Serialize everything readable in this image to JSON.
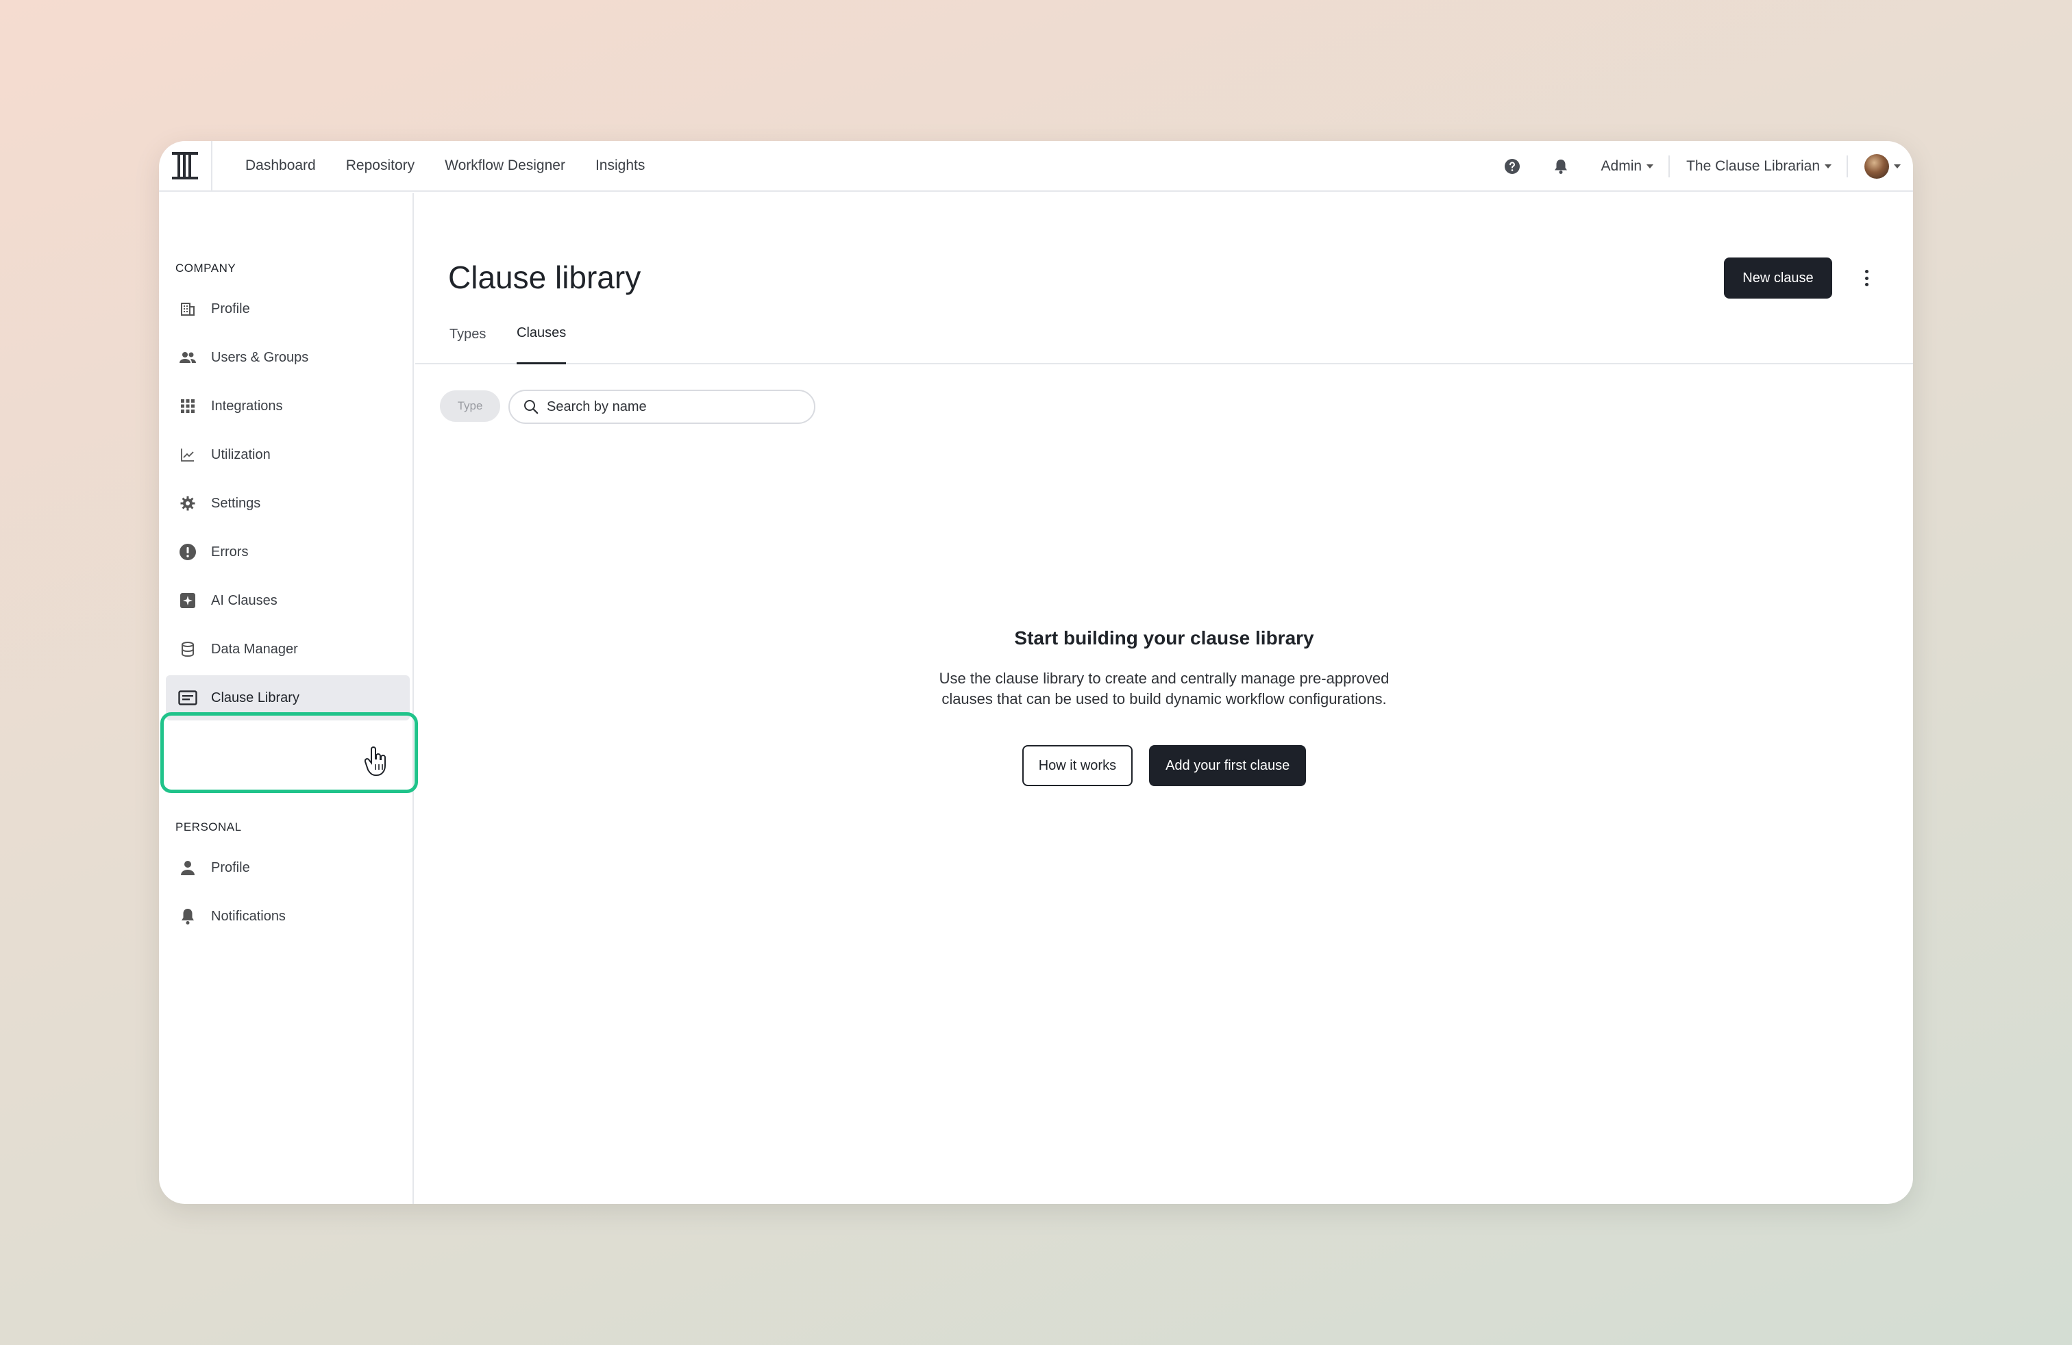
{
  "nav": {
    "items": [
      "Dashboard",
      "Repository",
      "Workflow Designer",
      "Insights"
    ]
  },
  "topbar": {
    "help_icon": "question-circle-icon",
    "notifications_icon": "bell-icon",
    "role_label": "Admin",
    "workspace_label": "The Clause Librarian"
  },
  "sidebar": {
    "company_label": "COMPANY",
    "company_items": [
      {
        "label": "Profile",
        "icon": "building-icon"
      },
      {
        "label": "Users & Groups",
        "icon": "users-icon"
      },
      {
        "label": "Integrations",
        "icon": "grid-icon"
      },
      {
        "label": "Utilization",
        "icon": "chart-line-icon"
      },
      {
        "label": "Settings",
        "icon": "gear-icon"
      },
      {
        "label": "Errors",
        "icon": "alert-circle-icon"
      },
      {
        "label": "AI Clauses",
        "icon": "sparkle-square-icon"
      },
      {
        "label": "Data Manager",
        "icon": "database-icon"
      },
      {
        "label": "Clause Library",
        "icon": "library-card-icon",
        "active": true
      }
    ],
    "personal_label": "PERSONAL",
    "personal_items": [
      {
        "label": "Profile",
        "icon": "person-icon"
      },
      {
        "label": "Notifications",
        "icon": "bell-icon"
      }
    ]
  },
  "main": {
    "title": "Clause library",
    "new_button": "New clause",
    "tabs": [
      {
        "label": "Types",
        "active": false
      },
      {
        "label": "Clauses",
        "active": true
      }
    ],
    "filter_pill": "Type",
    "search_placeholder": "Search by name",
    "empty_state": {
      "heading": "Start building your clause library",
      "line1": "Use the clause library to create and centrally manage pre-approved",
      "line2": "clauses that can be used to build dynamic workflow configurations.",
      "secondary_button": "How it works",
      "primary_button": "Add your first clause"
    }
  },
  "colors": {
    "accent_highlight": "#20c38a",
    "primary_button": "#1d2129",
    "active_item_bg": "#e9eaee"
  }
}
